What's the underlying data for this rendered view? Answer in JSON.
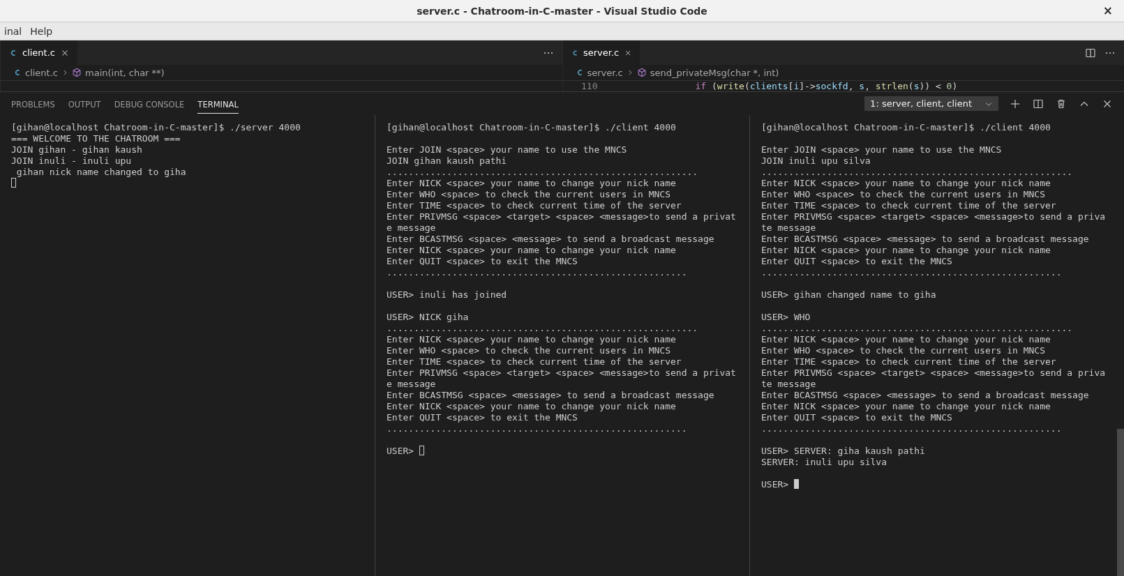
{
  "window": {
    "title": "server.c - Chatroom-in-C-master - Visual Studio Code",
    "close": "×"
  },
  "menu": [
    {
      "label": "inal"
    },
    {
      "label": "Help"
    }
  ],
  "editor_groups": [
    {
      "tabs": [
        {
          "label": "client.c",
          "selected": true
        }
      ],
      "breadcrumb": {
        "file": "client.c",
        "symbol": "main(int, char **)"
      },
      "actions": [
        {
          "kind": "more"
        }
      ]
    },
    {
      "tabs": [
        {
          "label": "server.c",
          "selected": true
        }
      ],
      "breadcrumb": {
        "file": "server.c",
        "symbol": "send_privateMsg(char *, int)"
      },
      "actions": [
        {
          "kind": "split"
        },
        {
          "kind": "more"
        }
      ],
      "code_line": {
        "number": "110",
        "text": "if (write(clients[i]->sockfd, s, strlen(s)) < 0)"
      }
    }
  ],
  "panel": {
    "tabs": [
      {
        "label": "PROBLEMS",
        "selected": false
      },
      {
        "label": "OUTPUT",
        "selected": false
      },
      {
        "label": "DEBUG CONSOLE",
        "selected": false
      },
      {
        "label": "TERMINAL",
        "selected": true
      }
    ],
    "terminal_select": {
      "value": "1: server, client, client"
    },
    "actions": [
      {
        "kind": "new"
      },
      {
        "kind": "split"
      },
      {
        "kind": "kill"
      },
      {
        "kind": "maximize"
      },
      {
        "kind": "close"
      }
    ]
  },
  "terminal_panes": [
    {
      "scrollable": false,
      "cursor": {
        "focused": false,
        "own_line": true
      },
      "blocks": [
        [
          "[gihan@localhost Chatroom-in-C-master]$ ./server 4000",
          "=== WELCOME TO THE CHATROOM ===",
          "JOIN gihan - gihan kaush",
          "JOIN inuli - inuli upu",
          " gihan nick name changed to giha"
        ]
      ]
    },
    {
      "scrollable": false,
      "cursor": {
        "focused": false,
        "own_line": false
      },
      "blocks": [
        [
          "[gihan@localhost Chatroom-in-C-master]$ ./client 4000"
        ],
        [
          "Enter JOIN <space> your name to use the MNCS",
          "JOIN gihan kaush pathi",
          ".........................................................",
          "Enter NICK <space> your name to change your nick name",
          "Enter WHO <space> to check the current users in MNCS",
          "Enter TIME <space> to check current time of the server",
          "Enter PRIVMSG <space> <target> <space> <message>to send a privat",
          "e message",
          "Enter BCASTMSG <space> <message> to send a broadcast message",
          "Enter NICK <space> your name to change your nick name",
          "Enter QUIT <space> to exit the MNCS",
          "......................................................."
        ],
        [
          "USER> inuli has joined"
        ],
        [
          "USER> NICK giha",
          ".........................................................",
          "Enter NICK <space> your name to change your nick name",
          "Enter WHO <space> to check the current users in MNCS",
          "Enter TIME <space> to check current time of the server",
          "Enter PRIVMSG <space> <target> <space> <message>to send a privat",
          "e message",
          "Enter BCASTMSG <space> <message> to send a broadcast message",
          "Enter NICK <space> your name to change your nick name",
          "Enter QUIT <space> to exit the MNCS",
          "......................................................."
        ],
        [
          "USER> "
        ]
      ]
    },
    {
      "scrollable": true,
      "cursor": {
        "focused": true,
        "own_line": false
      },
      "blocks": [
        [
          "[gihan@localhost Chatroom-in-C-master]$ ./client 4000"
        ],
        [
          "Enter JOIN <space> your name to use the MNCS",
          "JOIN inuli upu silva",
          ".........................................................",
          "Enter NICK <space> your name to change your nick name",
          "Enter WHO <space> to check the current users in MNCS",
          "Enter TIME <space> to check current time of the server",
          "Enter PRIVMSG <space> <target> <space> <message>to send a priva",
          "te message",
          "Enter BCASTMSG <space> <message> to send a broadcast message",
          "Enter NICK <space> your name to change your nick name",
          "Enter QUIT <space> to exit the MNCS",
          "......................................................."
        ],
        [
          "USER> gihan changed name to giha"
        ],
        [
          "USER> WHO",
          ".........................................................",
          "Enter NICK <space> your name to change your nick name",
          "Enter WHO <space> to check the current users in MNCS",
          "Enter TIME <space> to check current time of the server",
          "Enter PRIVMSG <space> <target> <space> <message>to send a priva",
          "te message",
          "Enter BCASTMSG <space> <message> to send a broadcast message",
          "Enter NICK <space> your name to change your nick name",
          "Enter QUIT <space> to exit the MNCS",
          "......................................................."
        ],
        [
          "USER> SERVER: giha kaush pathi",
          "SERVER: inuli upu silva"
        ],
        [
          "USER> "
        ]
      ]
    }
  ]
}
